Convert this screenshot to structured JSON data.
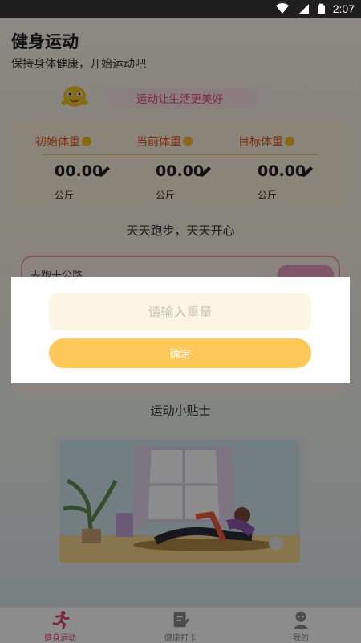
{
  "status_bar": {
    "time": "2:07",
    "icons": [
      "wifi-icon",
      "signal-icon",
      "battery-icon"
    ]
  },
  "header": {
    "title": "健身运动",
    "subtitle": "保持身体健康，开始运动吧"
  },
  "slogan": {
    "text": "运动让生活更美好",
    "mascot": "smiley-mascot-icon"
  },
  "weights": [
    {
      "label": "初始体重",
      "value": "00.00",
      "unit": "公斤",
      "icon": "edit-pencil-icon"
    },
    {
      "label": "当前体重",
      "value": "00.00",
      "unit": "公斤",
      "icon": "edit-pencil-icon"
    },
    {
      "label": "目标体重",
      "value": "00.00",
      "unit": "公斤",
      "icon": "edit-pencil-icon"
    }
  ],
  "run_section": {
    "title": "天天跑步，天天开心",
    "card_label": "去跑十公路"
  },
  "tips": {
    "title": "运动小贴士"
  },
  "dialog": {
    "input_placeholder": "请输入重量",
    "input_value": "",
    "confirm_label": "确定"
  },
  "tabs": [
    {
      "label": "健身运动",
      "icon": "running-person-icon",
      "active": true
    },
    {
      "label": "健康打卡",
      "icon": "checkin-note-icon",
      "active": false
    },
    {
      "label": "我的",
      "icon": "profile-icon",
      "active": false
    }
  ],
  "colors": {
    "accent_orange": "#e6561e",
    "button_yellow": "#fec95a",
    "slogan_pink": "#e5487b",
    "tab_active": "#e5486a",
    "tab_inactive": "#8a8a8a"
  }
}
